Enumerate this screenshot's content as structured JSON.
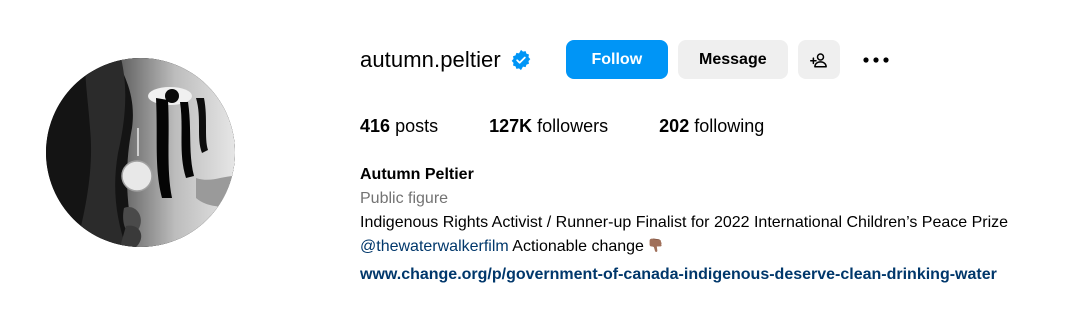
{
  "profile": {
    "username": "autumn.peltier",
    "verified": true,
    "follow_label": "Follow",
    "message_label": "Message",
    "posts_count": "416",
    "posts_label": "posts",
    "followers_count": "127K",
    "followers_label": "followers",
    "following_count": "202",
    "following_label": "following",
    "full_name": "Autumn Peltier",
    "category": "Public figure",
    "bio_line1": "Indigenous Rights Activist / Runner-up Finalist for 2022 International Children’s Peace Prize",
    "bio_mention": "@thewaterwalkerfilm",
    "bio_line2_rest": " Actionable change",
    "link": "www.change.org/p/government-of-canada-indigenous-deserve-clean-drinking-water"
  },
  "icons": {
    "verified": "verified-badge-icon",
    "add_user": "add-user-icon",
    "more": "more-options-icon",
    "emoji": "backhand-index-pointing-down-emoji"
  },
  "colors": {
    "follow_button": "#0095f6",
    "secondary_button": "#efefef",
    "verified_badge": "#0095f6",
    "link": "#00376b",
    "category": "#737373"
  }
}
